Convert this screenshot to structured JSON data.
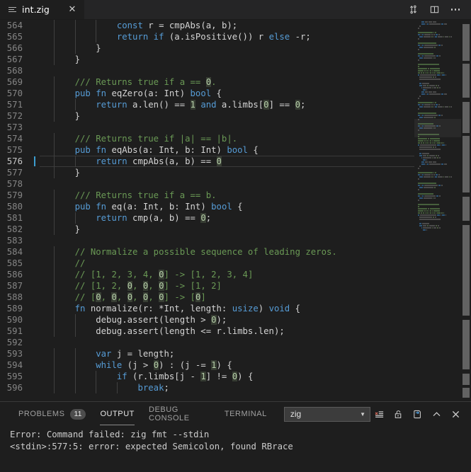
{
  "window": {
    "tab": {
      "filename": "int.zig",
      "file_icon": "file-lines-icon",
      "close_icon": "close-icon"
    },
    "actions": [
      {
        "name": "source-control-sync-icon",
        "title": "Sync Changes"
      },
      {
        "name": "split-editor-icon",
        "title": "Split Editor"
      },
      {
        "name": "more-actions-icon",
        "title": "More Actions..."
      }
    ]
  },
  "editor": {
    "language": "zig",
    "first_line": 564,
    "active_line": 576,
    "colors": {
      "background": "#1e1e1e",
      "comment": "#6A9955",
      "keyword": "#569CD6",
      "function": "#DCDCAA",
      "type": "#4EC9B0",
      "number": "#b5cea8",
      "plain": "#d4d4d4",
      "cursor": "#3c9dd0",
      "line_number": "#858585",
      "active_line_number": "#c6c6c6"
    },
    "lines": [
      {
        "n": 564,
        "indent": 3,
        "tokens": [
          {
            "t": "const",
            "c": "kw"
          },
          {
            "t": " r = ",
            "c": "pln"
          },
          {
            "t": "cmpAbs",
            "c": "pln"
          },
          {
            "t": "(a, b);",
            "c": "pln"
          }
        ]
      },
      {
        "n": 565,
        "indent": 3,
        "tokens": [
          {
            "t": "return",
            "c": "kw"
          },
          {
            "t": " ",
            "c": "pln"
          },
          {
            "t": "if",
            "c": "kw"
          },
          {
            "t": " (a.isPositive()) r ",
            "c": "pln"
          },
          {
            "t": "else",
            "c": "kw"
          },
          {
            "t": " -r;",
            "c": "pln"
          }
        ]
      },
      {
        "n": 566,
        "indent": 2,
        "tokens": [
          {
            "t": "}",
            "c": "pln"
          }
        ]
      },
      {
        "n": 567,
        "indent": 1,
        "tokens": [
          {
            "t": "}",
            "c": "pln"
          }
        ]
      },
      {
        "n": 568,
        "indent": 0,
        "tokens": []
      },
      {
        "n": 569,
        "indent": 1,
        "tokens": [
          {
            "t": "/// Returns true if a == ",
            "c": "com"
          },
          {
            "t": "0",
            "c": "num"
          },
          {
            "t": ".",
            "c": "com"
          }
        ]
      },
      {
        "n": 570,
        "indent": 1,
        "tokens": [
          {
            "t": "pub",
            "c": "kw"
          },
          {
            "t": " ",
            "c": "pln"
          },
          {
            "t": "fn",
            "c": "kw"
          },
          {
            "t": " eqZero(a: ",
            "c": "pln"
          },
          {
            "t": "Int",
            "c": "pln"
          },
          {
            "t": ") ",
            "c": "pln"
          },
          {
            "t": "bool",
            "c": "kw"
          },
          {
            "t": " {",
            "c": "pln"
          }
        ]
      },
      {
        "n": 571,
        "indent": 2,
        "tokens": [
          {
            "t": "return",
            "c": "kw"
          },
          {
            "t": " a.len() == ",
            "c": "pln"
          },
          {
            "t": "1",
            "c": "num"
          },
          {
            "t": " ",
            "c": "pln"
          },
          {
            "t": "and",
            "c": "kw"
          },
          {
            "t": " a.limbs[",
            "c": "pln"
          },
          {
            "t": "0",
            "c": "num"
          },
          {
            "t": "] == ",
            "c": "pln"
          },
          {
            "t": "0",
            "c": "num"
          },
          {
            "t": ";",
            "c": "pln"
          }
        ]
      },
      {
        "n": 572,
        "indent": 1,
        "tokens": [
          {
            "t": "}",
            "c": "pln"
          }
        ]
      },
      {
        "n": 573,
        "indent": 0,
        "tokens": []
      },
      {
        "n": 574,
        "indent": 1,
        "tokens": [
          {
            "t": "/// Returns true if |a| == |b|.",
            "c": "com"
          }
        ]
      },
      {
        "n": 575,
        "indent": 1,
        "tokens": [
          {
            "t": "pub",
            "c": "kw"
          },
          {
            "t": " ",
            "c": "pln"
          },
          {
            "t": "fn",
            "c": "kw"
          },
          {
            "t": " eqAbs(a: Int, b: Int) ",
            "c": "pln"
          },
          {
            "t": "bool",
            "c": "kw"
          },
          {
            "t": " {",
            "c": "pln"
          }
        ]
      },
      {
        "n": 576,
        "indent": 2,
        "tokens": [
          {
            "t": "return",
            "c": "kw"
          },
          {
            "t": " cmpAbs(a, b) == ",
            "c": "pln"
          },
          {
            "t": "0",
            "c": "num"
          }
        ]
      },
      {
        "n": 577,
        "indent": 1,
        "tokens": [
          {
            "t": "}",
            "c": "pln"
          }
        ]
      },
      {
        "n": 578,
        "indent": 0,
        "tokens": []
      },
      {
        "n": 579,
        "indent": 1,
        "tokens": [
          {
            "t": "/// Returns true if a == b.",
            "c": "com"
          }
        ]
      },
      {
        "n": 580,
        "indent": 1,
        "tokens": [
          {
            "t": "pub",
            "c": "kw"
          },
          {
            "t": " ",
            "c": "pln"
          },
          {
            "t": "fn",
            "c": "kw"
          },
          {
            "t": " eq(a: Int, b: Int) ",
            "c": "pln"
          },
          {
            "t": "bool",
            "c": "kw"
          },
          {
            "t": " {",
            "c": "pln"
          }
        ]
      },
      {
        "n": 581,
        "indent": 2,
        "tokens": [
          {
            "t": "return",
            "c": "kw"
          },
          {
            "t": " cmp(a, b) == ",
            "c": "pln"
          },
          {
            "t": "0",
            "c": "num"
          },
          {
            "t": ";",
            "c": "pln"
          }
        ]
      },
      {
        "n": 582,
        "indent": 1,
        "tokens": [
          {
            "t": "}",
            "c": "pln"
          }
        ]
      },
      {
        "n": 583,
        "indent": 0,
        "tokens": []
      },
      {
        "n": 584,
        "indent": 1,
        "tokens": [
          {
            "t": "// Normalize a possible sequence of leading zeros.",
            "c": "com"
          }
        ]
      },
      {
        "n": 585,
        "indent": 1,
        "tokens": [
          {
            "t": "//",
            "c": "com"
          }
        ]
      },
      {
        "n": 586,
        "indent": 1,
        "tokens": [
          {
            "t": "// [1, 2, 3, 4, ",
            "c": "com"
          },
          {
            "t": "0",
            "c": "num"
          },
          {
            "t": "] -> [1, 2, 3, 4]",
            "c": "com"
          }
        ]
      },
      {
        "n": 587,
        "indent": 1,
        "tokens": [
          {
            "t": "// [1, 2, ",
            "c": "com"
          },
          {
            "t": "0",
            "c": "num"
          },
          {
            "t": ", ",
            "c": "com"
          },
          {
            "t": "0",
            "c": "num"
          },
          {
            "t": ", ",
            "c": "com"
          },
          {
            "t": "0",
            "c": "num"
          },
          {
            "t": "] -> [1, 2]",
            "c": "com"
          }
        ]
      },
      {
        "n": 588,
        "indent": 1,
        "tokens": [
          {
            "t": "// [",
            "c": "com"
          },
          {
            "t": "0",
            "c": "num"
          },
          {
            "t": ", ",
            "c": "com"
          },
          {
            "t": "0",
            "c": "num"
          },
          {
            "t": ", ",
            "c": "com"
          },
          {
            "t": "0",
            "c": "num"
          },
          {
            "t": ", ",
            "c": "com"
          },
          {
            "t": "0",
            "c": "num"
          },
          {
            "t": ", ",
            "c": "com"
          },
          {
            "t": "0",
            "c": "num"
          },
          {
            "t": "] -> [",
            "c": "com"
          },
          {
            "t": "0",
            "c": "num"
          },
          {
            "t": "]",
            "c": "com"
          }
        ]
      },
      {
        "n": 589,
        "indent": 1,
        "tokens": [
          {
            "t": "fn",
            "c": "kw"
          },
          {
            "t": " normalize(r: *Int, length: ",
            "c": "pln"
          },
          {
            "t": "usize",
            "c": "kw"
          },
          {
            "t": ") ",
            "c": "pln"
          },
          {
            "t": "void",
            "c": "kw"
          },
          {
            "t": " {",
            "c": "pln"
          }
        ]
      },
      {
        "n": 590,
        "indent": 2,
        "tokens": [
          {
            "t": "debug.assert(length > ",
            "c": "pln"
          },
          {
            "t": "0",
            "c": "num"
          },
          {
            "t": ");",
            "c": "pln"
          }
        ]
      },
      {
        "n": 591,
        "indent": 2,
        "tokens": [
          {
            "t": "debug.assert(length <= r.limbs.len);",
            "c": "pln"
          }
        ]
      },
      {
        "n": 592,
        "indent": 0,
        "tokens": []
      },
      {
        "n": 593,
        "indent": 2,
        "tokens": [
          {
            "t": "var",
            "c": "kw"
          },
          {
            "t": " j = length;",
            "c": "pln"
          }
        ]
      },
      {
        "n": 594,
        "indent": 2,
        "tokens": [
          {
            "t": "while",
            "c": "kw"
          },
          {
            "t": " (j > ",
            "c": "pln"
          },
          {
            "t": "0",
            "c": "num"
          },
          {
            "t": ") : (j -= ",
            "c": "pln"
          },
          {
            "t": "1",
            "c": "num"
          },
          {
            "t": ") {",
            "c": "pln"
          }
        ]
      },
      {
        "n": 595,
        "indent": 3,
        "tokens": [
          {
            "t": "if",
            "c": "kw"
          },
          {
            "t": " (r.limbs[j - ",
            "c": "pln"
          },
          {
            "t": "1",
            "c": "num"
          },
          {
            "t": "] != ",
            "c": "pln"
          },
          {
            "t": "0",
            "c": "num"
          },
          {
            "t": ") {",
            "c": "pln"
          }
        ]
      },
      {
        "n": 596,
        "indent": 4,
        "tokens": [
          {
            "t": "break",
            "c": "kw"
          },
          {
            "t": ";",
            "c": "pln"
          }
        ]
      }
    ]
  },
  "panel": {
    "tabs": [
      {
        "label": "PROBLEMS",
        "badge": "11",
        "active": false
      },
      {
        "label": "OUTPUT",
        "badge": null,
        "active": true
      },
      {
        "label": "DEBUG CONSOLE",
        "badge": null,
        "active": false
      },
      {
        "label": "TERMINAL",
        "badge": null,
        "active": false
      }
    ],
    "channel": {
      "value": "zig",
      "caret_icon": "chevron-down-icon"
    },
    "actions": [
      {
        "name": "clear-output-icon",
        "title": "Clear Output"
      },
      {
        "name": "lock-scroll-icon",
        "title": "Turn Auto Scrolling Off"
      },
      {
        "name": "open-in-editor-icon",
        "title": "Open Output in Editor"
      },
      {
        "name": "chevron-up-icon",
        "title": "Maximize Panel Size"
      },
      {
        "name": "close-panel-icon",
        "title": "Close Panel"
      }
    ],
    "output_lines": [
      "Error: Command failed: zig fmt --stdin",
      "<stdin>:577:5: error: expected Semicolon, found RBrace"
    ]
  }
}
